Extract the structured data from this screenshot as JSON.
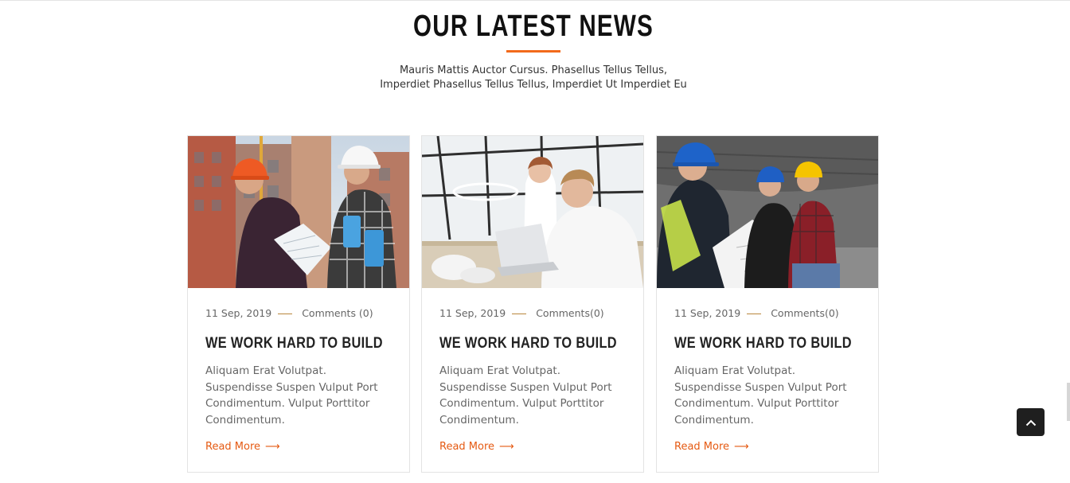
{
  "section": {
    "title": "OUR LATEST NEWS",
    "subtitle_line1": "Mauris Mattis Auctor Cursus. Phasellus Tellus Tellus,",
    "subtitle_line2": "Imperdiet Phasellus Tellus Tellus, Imperdiet Ut Imperdiet Eu"
  },
  "posts": [
    {
      "date": "11 Sep, 2019",
      "comments": "Comments (0)",
      "title": "WE WORK HARD TO BUILD",
      "excerpt": "Aliquam Erat Volutpat. Suspendisse Suspen Vulput Port Condimentum. Vulput Porttitor Condimentum.",
      "read_more": "Read More",
      "image": "two construction workers with helmets reviewing blueprints"
    },
    {
      "date": "11 Sep, 2019",
      "comments": "Comments(0)",
      "title": "WE WORK HARD TO BUILD",
      "excerpt": "Aliquam Erat Volutpat. Suspendisse Suspen Vulput Port Condimentum. Vulput Porttitor Condimentum.",
      "read_more": "Read More",
      "image": "two people working at a laptop in an office"
    },
    {
      "date": "11 Sep, 2019",
      "comments": "Comments(0)",
      "title": "WE WORK HARD TO BUILD",
      "excerpt": "Aliquam Erat Volutpat. Suspendisse Suspen Vulput Port Condimentum. Vulput Porttitor Condimentum.",
      "read_more": "Read More",
      "image": "three construction workers in helmets in a warehouse"
    }
  ],
  "ui": {
    "arrow_glyph": "⟶",
    "back_to_top_icon": "chevron-up-icon"
  },
  "colors": {
    "accent": "#f26a1b",
    "link": "#e55a12",
    "title": "#111111",
    "back_to_top_bg": "#1f1f1f"
  }
}
